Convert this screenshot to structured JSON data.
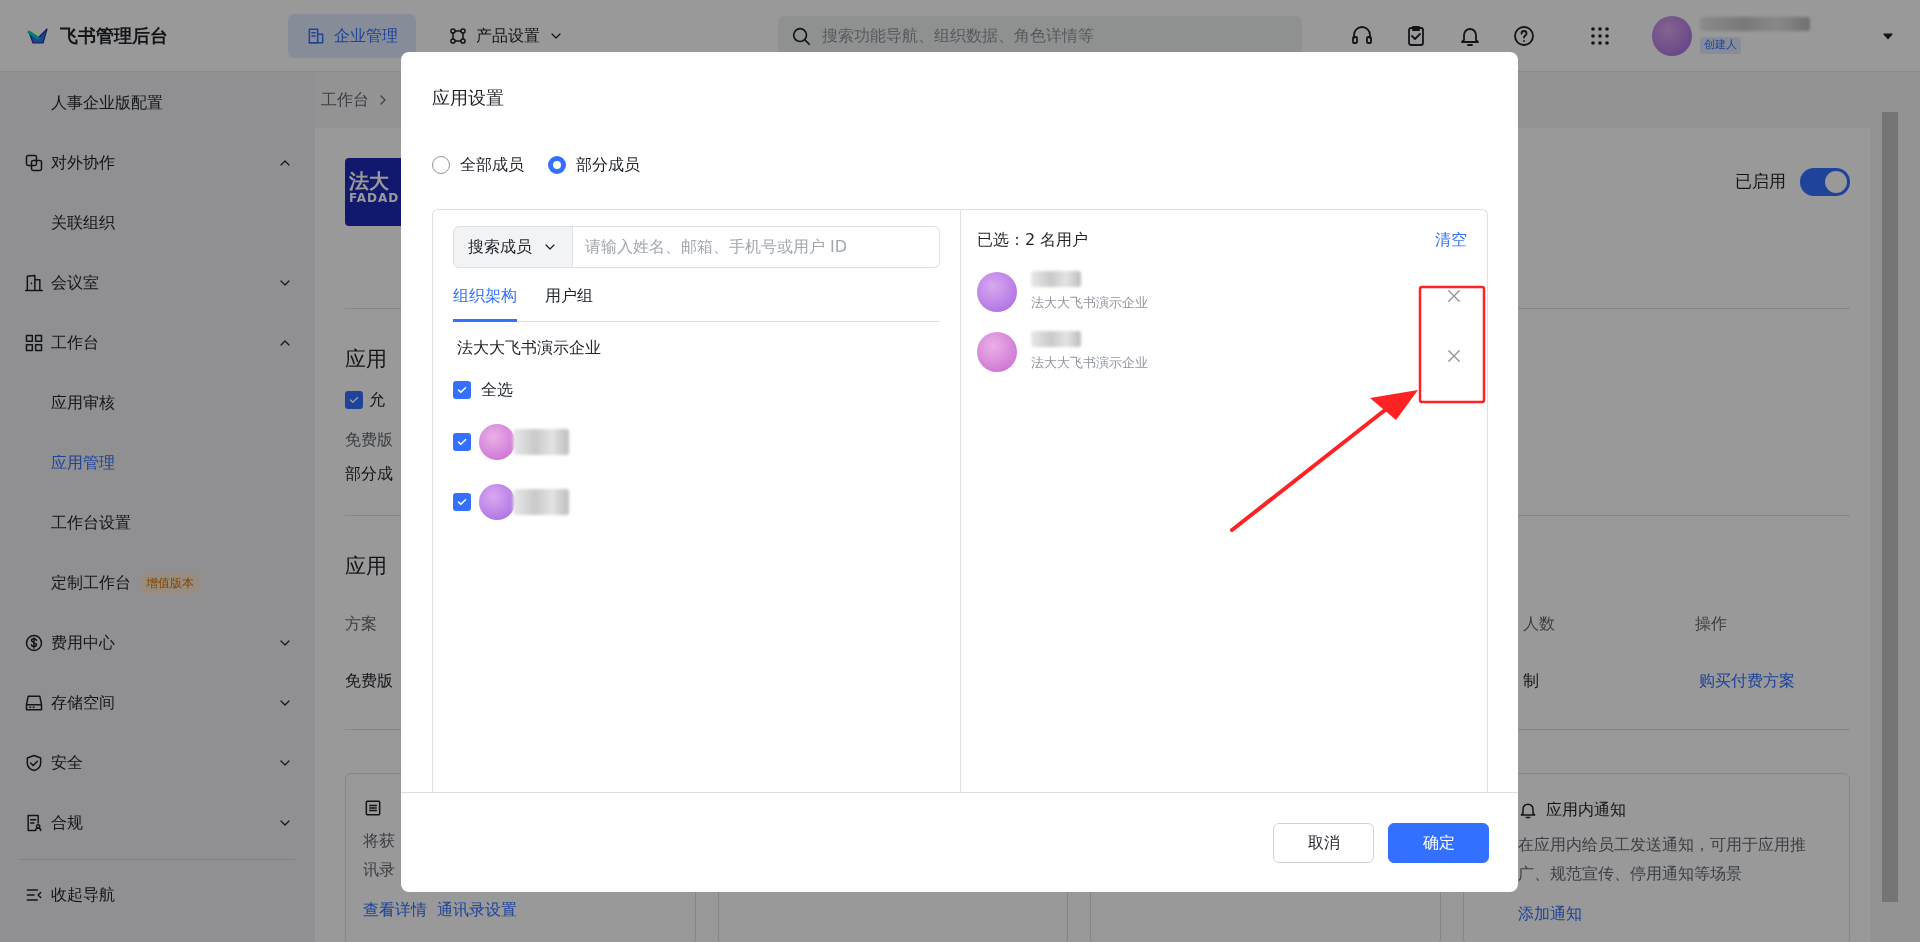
{
  "top_bar": {
    "product": "飞书管理后台",
    "tabs": [
      {
        "label": "企业管理",
        "selected": true,
        "kind": "building",
        "dropdown": false
      },
      {
        "label": "产品设置",
        "selected": false,
        "kind": "nodes",
        "dropdown": true
      }
    ],
    "search": {
      "placeholder": "搜索功能导航、组织数据、角色详情等"
    },
    "user_badge": "创建人"
  },
  "sidebar": {
    "leading_children": [
      {
        "label": "人事企业版配置",
        "selected": false
      }
    ],
    "items": [
      {
        "label": "对外协作",
        "expanded": true,
        "children": [
          {
            "label": "关联组织",
            "selected": false
          }
        ]
      },
      {
        "label": "会议室",
        "expanded": false
      },
      {
        "label": "工作台",
        "expanded": true,
        "children": [
          {
            "label": "应用审核",
            "selected": false
          },
          {
            "label": "应用管理",
            "selected": true
          },
          {
            "label": "工作台设置",
            "selected": false
          },
          {
            "label": "定制工作台",
            "selected": false,
            "badge": "增值版本"
          }
        ]
      },
      {
        "label": "费用中心",
        "expanded": false
      },
      {
        "label": "存储空间",
        "expanded": false
      },
      {
        "label": "安全",
        "expanded": false
      },
      {
        "label": "合规",
        "expanded": false
      }
    ],
    "collapse": "收起导航"
  },
  "breadcrumb": [
    "工作台"
  ],
  "app_page": {
    "logo": {
      "line1": "法大",
      "line2": "FADAD"
    },
    "status": {
      "label": "已启用",
      "on": true
    },
    "visibility": {
      "title": "应用",
      "allow": {
        "label": "允",
        "checked": true
      },
      "plan_note": "免费版",
      "scope": "部分成"
    },
    "pricing": {
      "title": "应用",
      "columns": [
        "方案",
        "人数",
        "操作"
      ],
      "row": [
        "免费版",
        "制",
        "购买付费方案"
      ]
    },
    "cards": [
      {
        "kind": "contacts",
        "lines": [
          "将获",
          "讯录"
        ],
        "links": [
          "查看详情",
          "通讯录设置"
        ]
      },
      {
        "kind": "blank"
      },
      {
        "kind": "blank"
      },
      {
        "kind": "notice",
        "title": "应用内通知",
        "lines": [
          "在应用内给员工发送通知，可用于应用推",
          "广、规范宣传、停用通知等场景"
        ],
        "links": [
          "添加通知"
        ]
      }
    ]
  },
  "dialog": {
    "title": "应用设置",
    "scope_options": [
      {
        "label": "全部成员",
        "selected": false
      },
      {
        "label": "部分成员",
        "selected": true
      }
    ],
    "search_mode": "搜索成员",
    "search": {
      "placeholder": "请输入姓名、邮箱、手机号或用户 ID"
    },
    "tabs": [
      {
        "label": "组织架构",
        "selected": true
      },
      {
        "label": "用户组",
        "selected": false
      }
    ],
    "org_name": "法大大飞书演示企业",
    "select_all": {
      "label": "全选",
      "checked": true
    },
    "members": [
      {
        "checked": true
      },
      {
        "checked": true
      }
    ],
    "selected_summary": "已选：2 名用户",
    "clear": "清空",
    "selected_users": [
      {
        "org": "法大大飞书演示企业"
      },
      {
        "org": "法大大飞书演示企业"
      }
    ],
    "buttons": [
      {
        "label": "取消",
        "kind": "secondary"
      },
      {
        "label": "确定",
        "kind": "primary"
      }
    ]
  }
}
